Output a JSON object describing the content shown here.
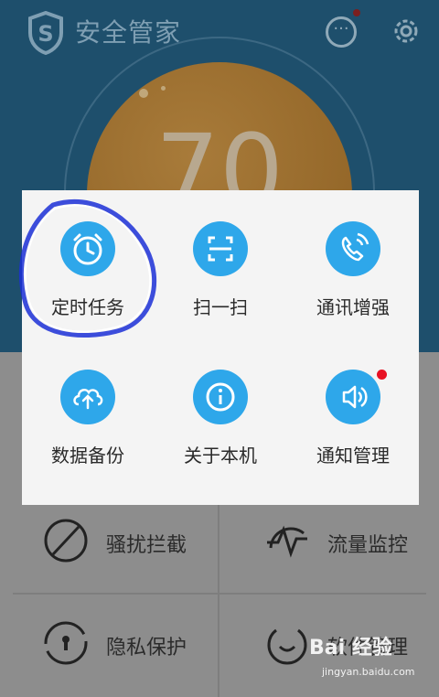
{
  "header": {
    "app_title": "安全管家",
    "score": "70"
  },
  "popup": {
    "items": [
      {
        "label": "定时任务",
        "icon": "alarm-clock-icon",
        "highlighted": true
      },
      {
        "label": "扫一扫",
        "icon": "scan-icon"
      },
      {
        "label": "通讯增强",
        "icon": "phone-icon"
      },
      {
        "label": "数据备份",
        "icon": "cloud-upload-icon"
      },
      {
        "label": "关于本机",
        "icon": "info-icon"
      },
      {
        "label": "通知管理",
        "icon": "speaker-icon",
        "has_badge": true
      }
    ]
  },
  "grid": {
    "items": [
      {
        "label": "骚扰拦截",
        "icon": "block-icon"
      },
      {
        "label": "流量监控",
        "icon": "pulse-icon"
      },
      {
        "label": "隐私保护",
        "icon": "lock-icon"
      },
      {
        "label": "软件管理",
        "icon": "software-icon"
      }
    ]
  },
  "watermark": {
    "brand": "Bai 经验",
    "url": "jingyan.baidu.com"
  },
  "colors": {
    "accent": "#2ea7ea",
    "badge": "#e81123",
    "highlight": "#1b2fd6"
  }
}
